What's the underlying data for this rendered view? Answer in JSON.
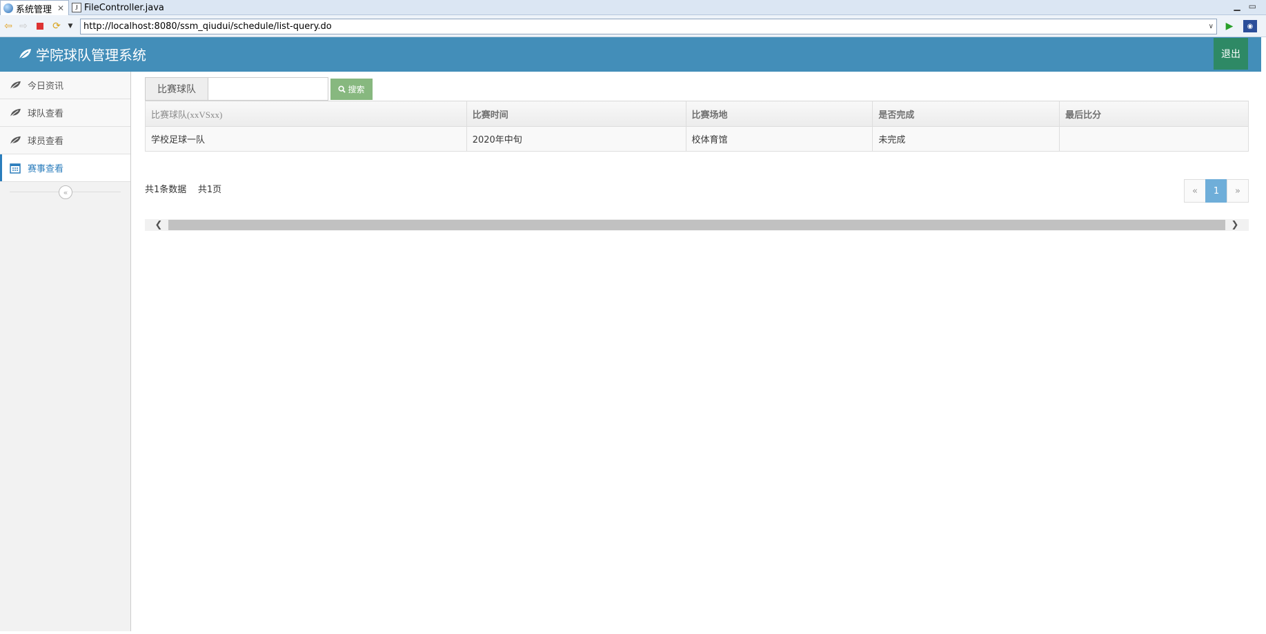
{
  "tabs": [
    {
      "label": "系统管理",
      "active": true
    },
    {
      "label": "FileController.java",
      "active": false
    }
  ],
  "address": {
    "url": "http://localhost:8080/ssm_qiudui/schedule/list-query.do"
  },
  "header": {
    "title": "学院球队管理系统",
    "logout": "退出"
  },
  "sidebar": {
    "items": [
      {
        "label": "今日资讯",
        "icon": "leaf-icon"
      },
      {
        "label": "球队查看",
        "icon": "leaf-icon"
      },
      {
        "label": "球员查看",
        "icon": "leaf-icon"
      },
      {
        "label": "赛事查看",
        "icon": "calendar-icon",
        "active": true
      }
    ]
  },
  "search": {
    "label": "比赛球队",
    "value": "",
    "button": "搜索"
  },
  "table": {
    "headers": [
      "比赛球队(xxVSxx)",
      "比赛时间",
      "比赛场地",
      "是否完成",
      "最后比分"
    ],
    "rows": [
      [
        "学校足球一队",
        "2020年中旬",
        "校体育馆",
        "未完成",
        ""
      ]
    ]
  },
  "pagination": {
    "total_records": "共1条数据",
    "total_pages": "共1页",
    "prev": "«",
    "current": "1",
    "next": "»"
  },
  "colors": {
    "header_bg": "#438eb9",
    "logout_bg": "#2e8965",
    "search_btn": "#87b87f",
    "active_page": "#6faed9"
  }
}
